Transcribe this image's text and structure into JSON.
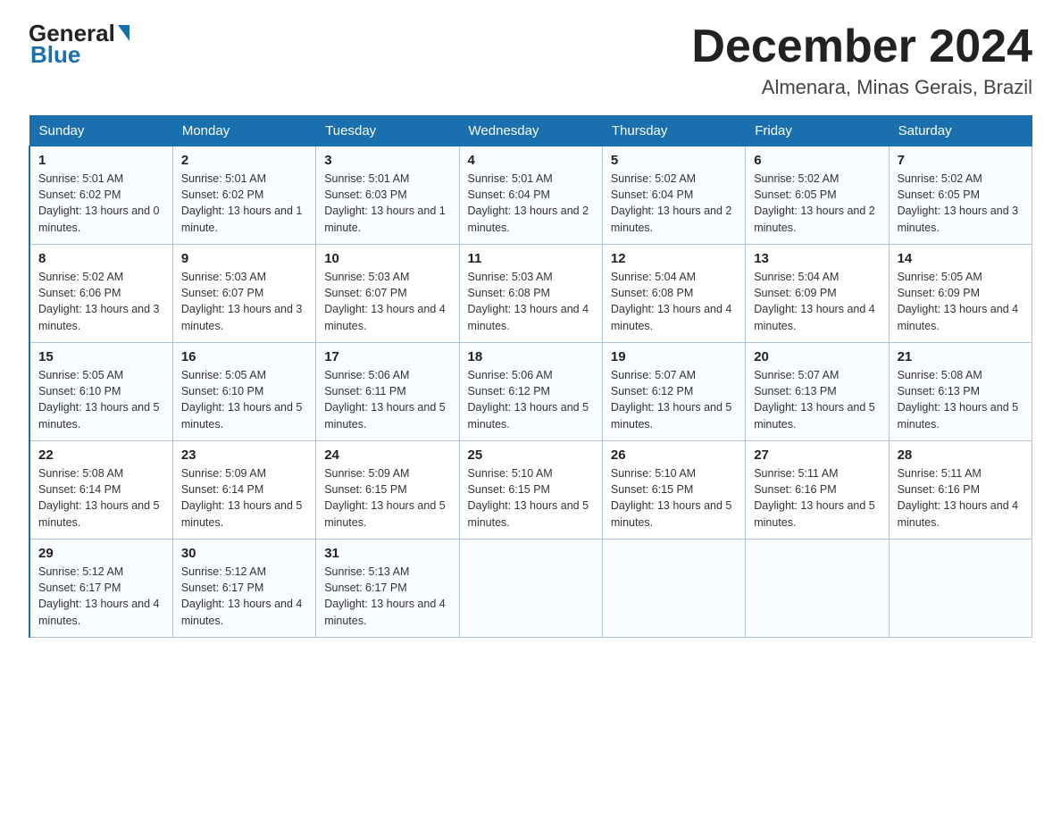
{
  "logo": {
    "general": "General",
    "blue": "Blue"
  },
  "title": "December 2024",
  "location": "Almenara, Minas Gerais, Brazil",
  "days_of_week": [
    "Sunday",
    "Monday",
    "Tuesday",
    "Wednesday",
    "Thursday",
    "Friday",
    "Saturday"
  ],
  "weeks": [
    [
      {
        "day": "1",
        "sunrise": "5:01 AM",
        "sunset": "6:02 PM",
        "daylight": "13 hours and 0 minutes."
      },
      {
        "day": "2",
        "sunrise": "5:01 AM",
        "sunset": "6:02 PM",
        "daylight": "13 hours and 1 minute."
      },
      {
        "day": "3",
        "sunrise": "5:01 AM",
        "sunset": "6:03 PM",
        "daylight": "13 hours and 1 minute."
      },
      {
        "day": "4",
        "sunrise": "5:01 AM",
        "sunset": "6:04 PM",
        "daylight": "13 hours and 2 minutes."
      },
      {
        "day": "5",
        "sunrise": "5:02 AM",
        "sunset": "6:04 PM",
        "daylight": "13 hours and 2 minutes."
      },
      {
        "day": "6",
        "sunrise": "5:02 AM",
        "sunset": "6:05 PM",
        "daylight": "13 hours and 2 minutes."
      },
      {
        "day": "7",
        "sunrise": "5:02 AM",
        "sunset": "6:05 PM",
        "daylight": "13 hours and 3 minutes."
      }
    ],
    [
      {
        "day": "8",
        "sunrise": "5:02 AM",
        "sunset": "6:06 PM",
        "daylight": "13 hours and 3 minutes."
      },
      {
        "day": "9",
        "sunrise": "5:03 AM",
        "sunset": "6:07 PM",
        "daylight": "13 hours and 3 minutes."
      },
      {
        "day": "10",
        "sunrise": "5:03 AM",
        "sunset": "6:07 PM",
        "daylight": "13 hours and 4 minutes."
      },
      {
        "day": "11",
        "sunrise": "5:03 AM",
        "sunset": "6:08 PM",
        "daylight": "13 hours and 4 minutes."
      },
      {
        "day": "12",
        "sunrise": "5:04 AM",
        "sunset": "6:08 PM",
        "daylight": "13 hours and 4 minutes."
      },
      {
        "day": "13",
        "sunrise": "5:04 AM",
        "sunset": "6:09 PM",
        "daylight": "13 hours and 4 minutes."
      },
      {
        "day": "14",
        "sunrise": "5:05 AM",
        "sunset": "6:09 PM",
        "daylight": "13 hours and 4 minutes."
      }
    ],
    [
      {
        "day": "15",
        "sunrise": "5:05 AM",
        "sunset": "6:10 PM",
        "daylight": "13 hours and 5 minutes."
      },
      {
        "day": "16",
        "sunrise": "5:05 AM",
        "sunset": "6:10 PM",
        "daylight": "13 hours and 5 minutes."
      },
      {
        "day": "17",
        "sunrise": "5:06 AM",
        "sunset": "6:11 PM",
        "daylight": "13 hours and 5 minutes."
      },
      {
        "day": "18",
        "sunrise": "5:06 AM",
        "sunset": "6:12 PM",
        "daylight": "13 hours and 5 minutes."
      },
      {
        "day": "19",
        "sunrise": "5:07 AM",
        "sunset": "6:12 PM",
        "daylight": "13 hours and 5 minutes."
      },
      {
        "day": "20",
        "sunrise": "5:07 AM",
        "sunset": "6:13 PM",
        "daylight": "13 hours and 5 minutes."
      },
      {
        "day": "21",
        "sunrise": "5:08 AM",
        "sunset": "6:13 PM",
        "daylight": "13 hours and 5 minutes."
      }
    ],
    [
      {
        "day": "22",
        "sunrise": "5:08 AM",
        "sunset": "6:14 PM",
        "daylight": "13 hours and 5 minutes."
      },
      {
        "day": "23",
        "sunrise": "5:09 AM",
        "sunset": "6:14 PM",
        "daylight": "13 hours and 5 minutes."
      },
      {
        "day": "24",
        "sunrise": "5:09 AM",
        "sunset": "6:15 PM",
        "daylight": "13 hours and 5 minutes."
      },
      {
        "day": "25",
        "sunrise": "5:10 AM",
        "sunset": "6:15 PM",
        "daylight": "13 hours and 5 minutes."
      },
      {
        "day": "26",
        "sunrise": "5:10 AM",
        "sunset": "6:15 PM",
        "daylight": "13 hours and 5 minutes."
      },
      {
        "day": "27",
        "sunrise": "5:11 AM",
        "sunset": "6:16 PM",
        "daylight": "13 hours and 5 minutes."
      },
      {
        "day": "28",
        "sunrise": "5:11 AM",
        "sunset": "6:16 PM",
        "daylight": "13 hours and 4 minutes."
      }
    ],
    [
      {
        "day": "29",
        "sunrise": "5:12 AM",
        "sunset": "6:17 PM",
        "daylight": "13 hours and 4 minutes."
      },
      {
        "day": "30",
        "sunrise": "5:12 AM",
        "sunset": "6:17 PM",
        "daylight": "13 hours and 4 minutes."
      },
      {
        "day": "31",
        "sunrise": "5:13 AM",
        "sunset": "6:17 PM",
        "daylight": "13 hours and 4 minutes."
      },
      null,
      null,
      null,
      null
    ]
  ]
}
